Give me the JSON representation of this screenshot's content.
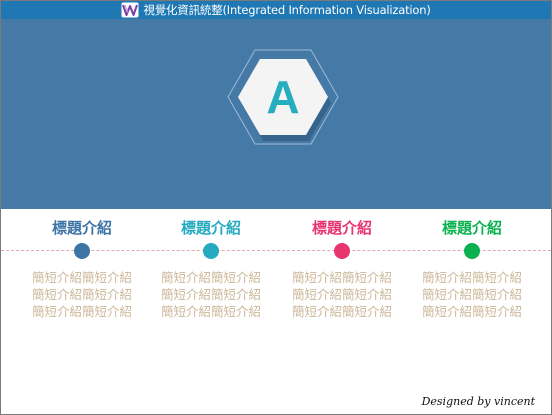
{
  "header": {
    "title": "視覺化資訊統整(Integrated Information Visualization)"
  },
  "hero": {
    "letter": "A",
    "hex_color": "#27aebe",
    "background": "#4579a6"
  },
  "columns": [
    {
      "title": "標題介紹",
      "color": "#3d74a6",
      "desc": [
        "簡短介紹簡短介紹",
        "簡短介紹簡短介紹",
        "簡短介紹簡短介紹"
      ]
    },
    {
      "title": "標題介紹",
      "color": "#25aabf",
      "desc": [
        "簡短介紹簡短介紹",
        "簡短介紹簡短介紹",
        "簡短介紹簡短介紹"
      ]
    },
    {
      "title": "標題介紹",
      "color": "#e8356f",
      "desc": [
        "簡短介紹簡短介紹",
        "簡短介紹簡短介紹",
        "簡短介紹簡短介紹"
      ]
    },
    {
      "title": "標題介紹",
      "color": "#0bb14f",
      "desc": [
        "簡短介紹簡短介紹",
        "簡短介紹簡短介紹",
        "簡短介紹簡短介紹"
      ]
    }
  ],
  "footer": {
    "credit": "Designed by vincent"
  }
}
